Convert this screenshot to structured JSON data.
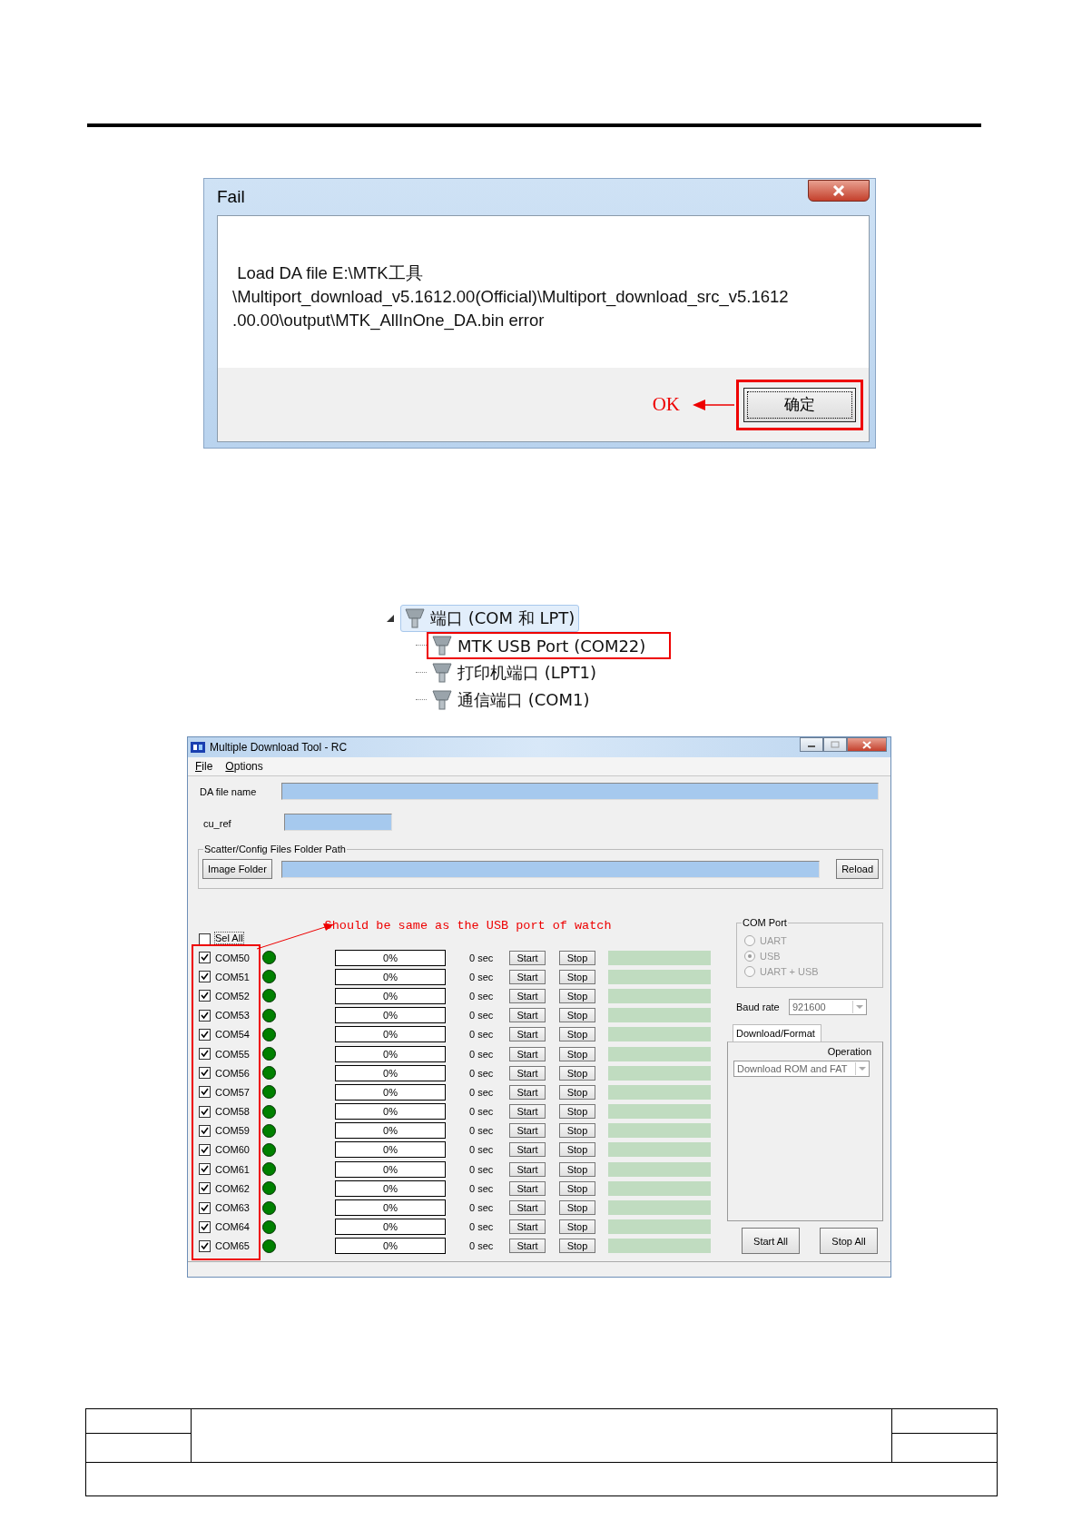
{
  "fail_dialog": {
    "title": "Fail",
    "message": [
      " Load DA file E:\\MTK工具",
      "\\Multiport_download_v5.1612.00(Official)\\Multiport_download_src_v5.1612",
      ".00.00\\output\\MTK_AllInOne_DA.bin error"
    ],
    "button": "确定",
    "annotation": "OK"
  },
  "device_tree": {
    "items": [
      {
        "label": "端口 (COM 和 LPT)",
        "expanded": true,
        "selected": true,
        "children": [
          {
            "label": "MTK USB Port (COM22)",
            "annotated": true
          },
          {
            "label": "打印机端口 (LPT1)",
            "annotated": false
          },
          {
            "label": "通信端口 (COM1)",
            "annotated": false
          }
        ]
      }
    ]
  },
  "tool_window": {
    "title": "Multiple Download Tool - RC",
    "menu": [
      "File",
      "Options"
    ],
    "da_file_label": "DA file name",
    "cu_ref_label": "cu_ref",
    "folder_group": {
      "title": "Scatter/Config Files Folder Path",
      "image_button": "Image Folder",
      "reload_button": "Reload"
    },
    "sel_all": {
      "label": "Sel All",
      "checked": false
    },
    "annotation": "Should be same as the USB port of watch",
    "ports": [
      {
        "name": "COM50",
        "checked": true,
        "color": "#008000",
        "progress": "0%",
        "level": 0,
        "time": "0 sec",
        "start": "Start",
        "stop": "Stop"
      },
      {
        "name": "COM51",
        "checked": true,
        "color": "#008000",
        "progress": "0%",
        "level": 0,
        "time": "0 sec",
        "start": "Start",
        "stop": "Stop"
      },
      {
        "name": "COM52",
        "checked": true,
        "color": "#008000",
        "progress": "0%",
        "level": 0,
        "time": "0 sec",
        "start": "Start",
        "stop": "Stop"
      },
      {
        "name": "COM53",
        "checked": true,
        "color": "#008000",
        "progress": "0%",
        "level": 0,
        "time": "0 sec",
        "start": "Start",
        "stop": "Stop"
      },
      {
        "name": "COM54",
        "checked": true,
        "color": "#008000",
        "progress": "0%",
        "level": 0,
        "time": "0 sec",
        "start": "Start",
        "stop": "Stop"
      },
      {
        "name": "COM55",
        "checked": true,
        "color": "#008000",
        "progress": "0%",
        "level": 0,
        "time": "0 sec",
        "start": "Start",
        "stop": "Stop"
      },
      {
        "name": "COM56",
        "checked": true,
        "color": "#008000",
        "progress": "0%",
        "level": 0,
        "time": "0 sec",
        "start": "Start",
        "stop": "Stop"
      },
      {
        "name": "COM57",
        "checked": true,
        "color": "#008000",
        "progress": "0%",
        "level": 0,
        "time": "0 sec",
        "start": "Start",
        "stop": "Stop"
      },
      {
        "name": "COM58",
        "checked": true,
        "color": "#008000",
        "progress": "0%",
        "level": 0,
        "time": "0 sec",
        "start": "Start",
        "stop": "Stop"
      },
      {
        "name": "COM59",
        "checked": true,
        "color": "#008000",
        "progress": "0%",
        "level": 0,
        "time": "0 sec",
        "start": "Start",
        "stop": "Stop"
      },
      {
        "name": "COM60",
        "checked": true,
        "color": "#008000",
        "progress": "0%",
        "level": 0,
        "time": "0 sec",
        "start": "Start",
        "stop": "Stop"
      },
      {
        "name": "COM61",
        "checked": true,
        "color": "#008000",
        "progress": "0%",
        "level": 0,
        "time": "0 sec",
        "start": "Start",
        "stop": "Stop"
      },
      {
        "name": "COM62",
        "checked": true,
        "color": "#008000",
        "progress": "0%",
        "level": 0,
        "time": "0 sec",
        "start": "Start",
        "stop": "Stop"
      },
      {
        "name": "COM63",
        "checked": true,
        "color": "#008000",
        "progress": "0%",
        "level": 0,
        "time": "0 sec",
        "start": "Start",
        "stop": "Stop"
      },
      {
        "name": "COM64",
        "checked": true,
        "color": "#008000",
        "progress": "0%",
        "level": 0,
        "time": "0 sec",
        "start": "Start",
        "stop": "Stop"
      },
      {
        "name": "COM65",
        "checked": true,
        "color": "#008000",
        "progress": "0%",
        "level": 0,
        "time": "0 sec",
        "start": "Start",
        "stop": "Stop"
      }
    ],
    "com_port": {
      "title": "COM Port",
      "disabled": true,
      "options": [
        {
          "label": "UART",
          "selected": false
        },
        {
          "label": "USB",
          "selected": true
        },
        {
          "label": "UART + USB",
          "selected": false
        }
      ]
    },
    "baud_rate": {
      "label": "Baud rate",
      "value": "921600"
    },
    "tabs": [
      {
        "label": "Download/Format",
        "selected": true
      }
    ],
    "operation": {
      "label": "Operation",
      "value": "Download ROM and FAT"
    },
    "buttons": [
      "Start All",
      "Stop All"
    ]
  }
}
